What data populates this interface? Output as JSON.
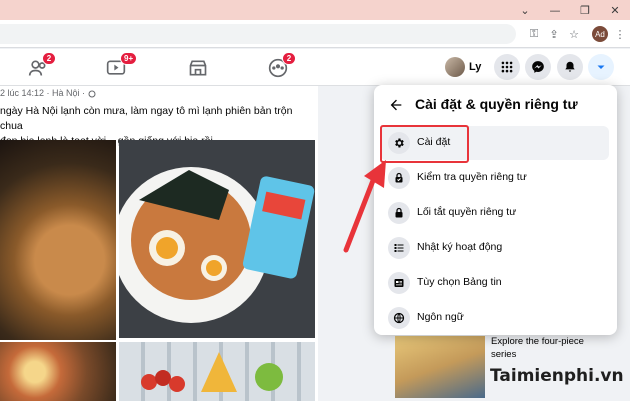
{
  "browser": {
    "window_controls": [
      "chevron-down-icon",
      "minimize-icon",
      "restore-icon",
      "close-icon"
    ],
    "profile_initials": "Ad"
  },
  "nav": {
    "friends_badge": "2",
    "watch_badge": "9+",
    "groups_badge": "2",
    "user_name": "Ly"
  },
  "post": {
    "meta": "2 lúc 14:12 · Hà Nội ·",
    "text_line1": "ngày Hà Nội lạnh còn mưa, làm ngay tô mì lạnh phiên bản trộn chua",
    "text_line2": "đon bia lạnh là toẹt vời... gần giống với bia rồi."
  },
  "menu": {
    "title": "Cài đặt & quyền riêng tư",
    "items": [
      {
        "label": "Cài đặt",
        "icon": "gear-icon"
      },
      {
        "label": "Kiểm tra quyền riêng tư",
        "icon": "lock-check-icon"
      },
      {
        "label": "Lối tắt quyền riêng tư",
        "icon": "lock-icon"
      },
      {
        "label": "Nhật ký hoạt động",
        "icon": "list-icon"
      },
      {
        "label": "Tùy chọn Bảng tin",
        "icon": "newsfeed-icon"
      },
      {
        "label": "Ngôn ngữ",
        "icon": "globe-icon"
      }
    ]
  },
  "sidebar": {
    "sponsor_line1": "Explore the four-piece",
    "sponsor_line2": "series",
    "watermark": "Taimienphi.vn"
  },
  "colors": {
    "accent": "#1877f2",
    "badge": "#e41e3f",
    "annotation": "#e8343a",
    "titlebar": "#f5d3cd"
  }
}
